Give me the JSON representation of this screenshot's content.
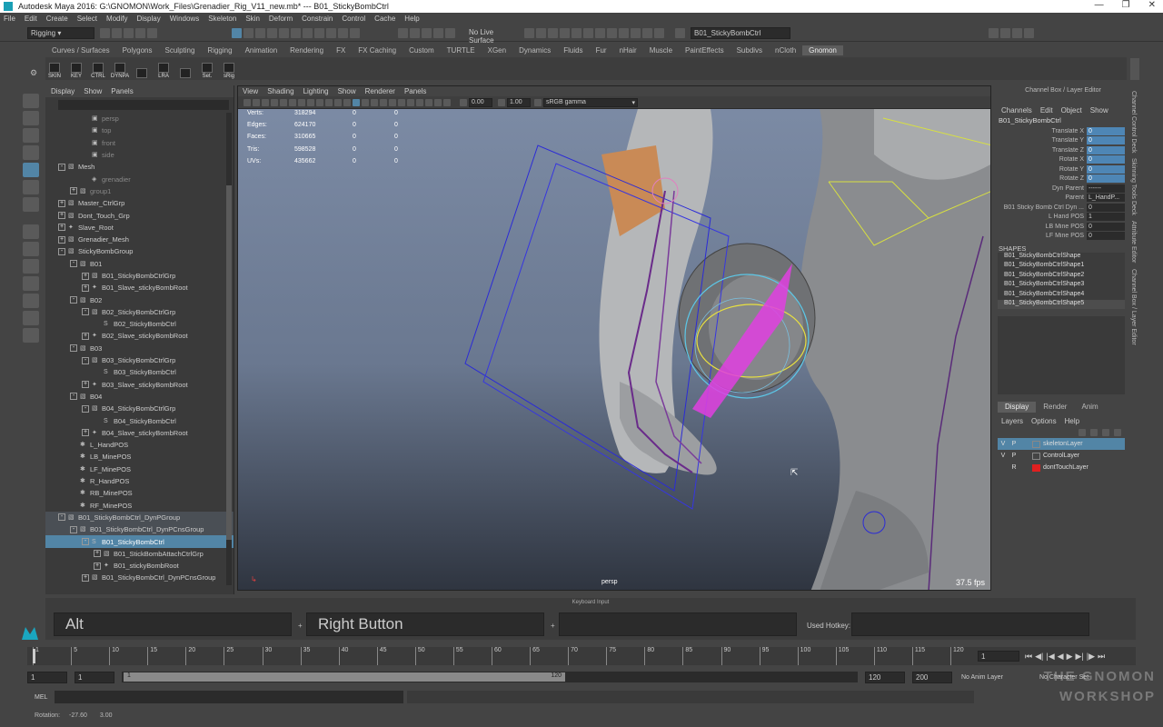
{
  "window": {
    "title": "Autodesk Maya 2016: G:\\GNOMON\\Work_Files\\Grenadier_Rig_V11_new.mb*   ---   B01_StickyBombCtrl"
  },
  "menubar": [
    "File",
    "Edit",
    "Create",
    "Select",
    "Modify",
    "Display",
    "Windows",
    "Skeleton",
    "Skin",
    "Deform",
    "Constrain",
    "Control",
    "Cache",
    "Help"
  ],
  "status": {
    "menuset": "Rigging",
    "live_surface": "No Live Surface",
    "selection_field": "B01_StickyBombCtrl"
  },
  "shelf": {
    "tabs": [
      "Curves / Surfaces",
      "Polygons",
      "Sculpting",
      "Rigging",
      "Animation",
      "Rendering",
      "FX",
      "FX Caching",
      "Custom",
      "TURTLE",
      "XGen",
      "Dynamics",
      "Fluids",
      "Fur",
      "nHair",
      "Muscle",
      "PaintEffects",
      "Subdivs",
      "nCloth",
      "Gnomon"
    ],
    "active_tab": "Gnomon",
    "buttons": [
      "SKIN",
      "KEY",
      "CTRL",
      "DYNPA",
      "",
      "LRA",
      "",
      "Set.",
      "sRig"
    ]
  },
  "outliner": {
    "menu": [
      "Display",
      "Show",
      "Panels"
    ],
    "items": [
      {
        "label": "persp",
        "indent": 2,
        "type": "cam",
        "dim": true
      },
      {
        "label": "top",
        "indent": 2,
        "type": "cam",
        "dim": true
      },
      {
        "label": "front",
        "indent": 2,
        "type": "cam",
        "dim": true
      },
      {
        "label": "side",
        "indent": 2,
        "type": "cam",
        "dim": true
      },
      {
        "label": "Mesh",
        "indent": 0,
        "exp": "-",
        "type": "grp"
      },
      {
        "label": "grenadier",
        "indent": 2,
        "type": "mesh",
        "dim": true
      },
      {
        "label": "group1",
        "indent": 1,
        "exp": "+",
        "type": "grp",
        "dim": true
      },
      {
        "label": "Master_CtrlGrp",
        "indent": 0,
        "exp": "+",
        "type": "grp"
      },
      {
        "label": "Dont_Touch_Grp",
        "indent": 0,
        "exp": "+",
        "type": "grp"
      },
      {
        "label": "Slave_Root",
        "indent": 0,
        "exp": "+",
        "type": "joint"
      },
      {
        "label": "Grenadier_Mesh",
        "indent": 0,
        "exp": "+",
        "type": "grp"
      },
      {
        "label": "StickyBombGroup",
        "indent": 0,
        "exp": "-",
        "type": "grp"
      },
      {
        "label": "B01",
        "indent": 1,
        "exp": "-",
        "type": "grp"
      },
      {
        "label": "B01_StickyBombCtrlGrp",
        "indent": 2,
        "exp": "+",
        "type": "grp"
      },
      {
        "label": "B01_Slave_stickyBombRoot",
        "indent": 2,
        "exp": "+",
        "type": "joint"
      },
      {
        "label": "B02",
        "indent": 1,
        "exp": "-",
        "type": "grp"
      },
      {
        "label": "B02_StickyBombCtrlGrp",
        "indent": 2,
        "exp": "-",
        "type": "grp"
      },
      {
        "label": "B02_StickyBombCtrl",
        "indent": 3,
        "type": "curve"
      },
      {
        "label": "B02_Slave_stickyBombRoot",
        "indent": 2,
        "exp": "+",
        "type": "joint"
      },
      {
        "label": "B03",
        "indent": 1,
        "exp": "-",
        "type": "grp"
      },
      {
        "label": "B03_StickyBombCtrlGrp",
        "indent": 2,
        "exp": "-",
        "type": "grp"
      },
      {
        "label": "B03_StickyBombCtrl",
        "indent": 3,
        "type": "curve"
      },
      {
        "label": "B03_Slave_stickyBombRoot",
        "indent": 2,
        "exp": "+",
        "type": "joint"
      },
      {
        "label": "B04",
        "indent": 1,
        "exp": "-",
        "type": "grp"
      },
      {
        "label": "B04_StickyBombCtrlGrp",
        "indent": 2,
        "exp": "-",
        "type": "grp"
      },
      {
        "label": "B04_StickyBombCtrl",
        "indent": 3,
        "type": "curve"
      },
      {
        "label": "B04_Slave_stickyBombRoot",
        "indent": 2,
        "exp": "+",
        "type": "joint"
      },
      {
        "label": "L_HandPOS",
        "indent": 1,
        "type": "loc"
      },
      {
        "label": "LB_MinePOS",
        "indent": 1,
        "type": "loc"
      },
      {
        "label": "LF_MinePOS",
        "indent": 1,
        "type": "loc"
      },
      {
        "label": "R_HandPOS",
        "indent": 1,
        "type": "loc"
      },
      {
        "label": "RB_MinePOS",
        "indent": 1,
        "type": "loc"
      },
      {
        "label": "RF_MinePOS",
        "indent": 1,
        "type": "loc"
      },
      {
        "label": "B01_StickyBombCtrl_DynPGroup",
        "indent": 0,
        "exp": "-",
        "type": "grp",
        "hl": true
      },
      {
        "label": "B01_StickyBombCtrl_DynPCnsGroup",
        "indent": 1,
        "exp": "-",
        "type": "grp",
        "hl": true
      },
      {
        "label": "B01_StickyBombCtrl",
        "indent": 2,
        "exp": "-",
        "type": "curve",
        "sel": true
      },
      {
        "label": "B01_StickBombAttachCtrlGrp",
        "indent": 3,
        "exp": "+",
        "type": "grp"
      },
      {
        "label": "B01_stickyBombRoot",
        "indent": 3,
        "exp": "+",
        "type": "joint"
      },
      {
        "label": "B01_StickyBombCtrl_DynPCnsGroup",
        "indent": 2,
        "exp": "+",
        "type": "grp"
      }
    ]
  },
  "viewport": {
    "menu": [
      "View",
      "Shading",
      "Lighting",
      "Show",
      "Renderer",
      "Panels"
    ],
    "exposure": "0.00",
    "gamma": "1.00",
    "colorspace": "sRGB gamma",
    "hud": [
      {
        "k": "Verts:",
        "v": "318294",
        "a": "0",
        "b": "0"
      },
      {
        "k": "Edges:",
        "v": "624170",
        "a": "0",
        "b": "0"
      },
      {
        "k": "Faces:",
        "v": "310665",
        "a": "0",
        "b": "0"
      },
      {
        "k": "Tris:",
        "v": "598528",
        "a": "0",
        "b": "0"
      },
      {
        "k": "UVs:",
        "v": "435662",
        "a": "0",
        "b": "0"
      }
    ],
    "camera": "persp",
    "fps": "37.5 fps"
  },
  "channelbox": {
    "title": "Channel Box / Layer Editor",
    "menu": [
      "Channels",
      "Edit",
      "Object",
      "Show"
    ],
    "node": "B01_StickyBombCtrl",
    "channels": [
      {
        "n": "Translate X",
        "v": "0",
        "blue": true
      },
      {
        "n": "Translate Y",
        "v": "0",
        "blue": true
      },
      {
        "n": "Translate Z",
        "v": "0",
        "blue": true
      },
      {
        "n": "Rotate X",
        "v": "0",
        "blue": true
      },
      {
        "n": "Rotate Y",
        "v": "0",
        "blue": true
      },
      {
        "n": "Rotate Z",
        "v": "0",
        "blue": true
      },
      {
        "n": "Dyn Parent",
        "v": "------"
      },
      {
        "n": "Parent",
        "v": "L_HandP..."
      },
      {
        "n": "B01 Sticky Bomb Ctrl Dyn ...",
        "v": "0"
      },
      {
        "n": "L Hand POS",
        "v": "1"
      },
      {
        "n": "LB Mine POS",
        "v": "0"
      },
      {
        "n": "LF Mine POS",
        "v": "0"
      }
    ],
    "shapes_header": "SHAPES",
    "shapes": [
      "B01_StickyBombCtrlShape",
      "B01_StickyBombCtrlShape1",
      "B01_StickyBombCtrlShape2",
      "B01_StickyBombCtrlShape3",
      "B01_StickyBombCtrlShape4",
      "B01_StickyBombCtrlShape5"
    ],
    "layer_tabs": [
      "Display",
      "Render",
      "Anim"
    ],
    "layer_menu": [
      "Layers",
      "Options",
      "Help"
    ],
    "layers": [
      {
        "v": "V",
        "p": "P",
        "name": "skeletonLayer",
        "color": "",
        "sel": true
      },
      {
        "v": "V",
        "p": "P",
        "name": "ControlLayer",
        "color": ""
      },
      {
        "v": "",
        "p": "R",
        "name": "dontTouchLayer",
        "color": "#e02020"
      }
    ]
  },
  "sidetabs": [
    "Channel Control Deck",
    "Skinning Tools Deck",
    "Attribute Editor",
    "Channel Box / Layer Editor"
  ],
  "keyboard": {
    "title": "Keyboard Input",
    "key1": "Alt",
    "key2": "Right Button",
    "key3": "",
    "used_label": "Used Hotkey:",
    "used_value": ""
  },
  "timeline": {
    "ticks": [
      "1",
      "5",
      "10",
      "15",
      "20",
      "25",
      "30",
      "35",
      "40",
      "45",
      "50",
      "55",
      "60",
      "65",
      "70",
      "75",
      "80",
      "85",
      "90",
      "95",
      "100",
      "105",
      "110",
      "115",
      "120"
    ],
    "current_frame": "1"
  },
  "range": {
    "start": "1",
    "start2": "1",
    "slider_start": "1",
    "slider_end": "120",
    "end": "120",
    "end2": "200",
    "anim_layer": "No Anim Layer",
    "char_set": "No Character Set"
  },
  "mel": {
    "label": "MEL"
  },
  "help": {
    "label": "Rotation:",
    "x": "-27.60",
    "y": "3.00"
  },
  "watermark": "THE GNOMON WORKSHOP",
  "colors": {
    "selection": "#5285a6",
    "bg": "#444444",
    "viewport_top": "#7d8ca6",
    "viewport_bottom": "#2f3540"
  }
}
